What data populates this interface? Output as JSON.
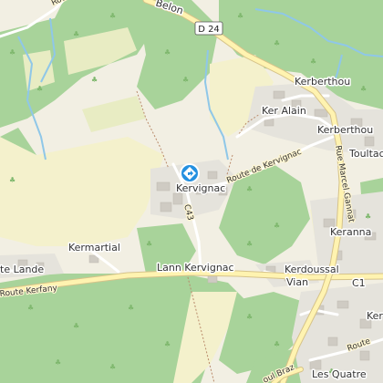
{
  "map": {
    "colors": {
      "land": "#f2efe3",
      "forest": "#a8d39a",
      "forest_dark": "#8fc47f",
      "meadow": "#e8ecc3",
      "field": "#f4f1cc",
      "residential": "#e5e3dc",
      "building": "#cfcbc3",
      "water": "#8fc7e8",
      "road_main": "#fff3b0",
      "road_casing": "#d6c38a",
      "road_minor": "#ffffff",
      "track": "#b98a6a",
      "marker": "#2490e0"
    },
    "marker": {
      "icon": "direction-diamond-icon",
      "label": "Kervignac"
    },
    "road_shield": "D 24",
    "places": [
      {
        "id": "kervignac",
        "text": "Kervignac"
      },
      {
        "id": "kerberthou-1",
        "text": "Kerberthou"
      },
      {
        "id": "kerberthou-2",
        "text": "Kerberthou"
      },
      {
        "id": "ker-alain",
        "text": "Ker Alain"
      },
      {
        "id": "toultac",
        "text": "Toultac"
      },
      {
        "id": "keranna",
        "text": "Keranna"
      },
      {
        "id": "kermartial",
        "text": "Kermartial"
      },
      {
        "id": "lande",
        "text": "te Lande"
      },
      {
        "id": "lann-kervignac",
        "text": "Lann Kervignac"
      },
      {
        "id": "kerdoussal-vian",
        "text": "Kerdoussal\nVian"
      },
      {
        "id": "les-quatre",
        "text": "Les Quatre"
      },
      {
        "id": "belon",
        "text": "Belon"
      },
      {
        "id": "ker-partial",
        "text": "Ker"
      }
    ],
    "roads": [
      {
        "id": "route-de-kervignac",
        "text": "Route de Kervignac"
      },
      {
        "id": "route-kerfany",
        "text": "Route Kerfany"
      },
      {
        "id": "rue-marcel-gannat",
        "text": "Rue Marcel Gannat"
      },
      {
        "id": "c43",
        "text": "C43"
      },
      {
        "id": "c1",
        "text": "C1"
      },
      {
        "id": "route-right",
        "text": "Route"
      },
      {
        "id": "route-du",
        "text": "Route d"
      },
      {
        "id": "braz",
        "text": "oul Braz"
      }
    ]
  }
}
